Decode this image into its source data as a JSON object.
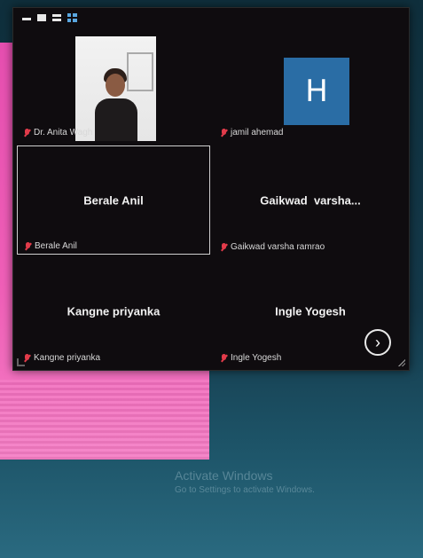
{
  "toolbar": {
    "icons": [
      "minimize-icon",
      "maximize-icon",
      "two-row-layout-icon",
      "grid-layout-icon"
    ]
  },
  "participants": [
    {
      "label": "Dr. Anita Wagh",
      "display": "video",
      "muted": true
    },
    {
      "label": "jamil ahemad",
      "display": "avatar",
      "avatar_letter": "H",
      "avatar_color": "#2a6da5",
      "muted": true
    },
    {
      "label": "Berale Anil",
      "display": "name",
      "center_name": "Berale Anil",
      "muted": true,
      "selected": true
    },
    {
      "label": "Gaikwad varsha ramrao",
      "display": "name",
      "center_name": "Gaikwad  varsha...",
      "muted": true
    },
    {
      "label": "Kangne priyanka",
      "display": "name",
      "center_name": "Kangne priyanka",
      "muted": true
    },
    {
      "label": "Ingle Yogesh",
      "display": "name",
      "center_name": "Ingle Yogesh",
      "muted": true
    }
  ],
  "next_button": {
    "glyph": "›"
  },
  "watermark": {
    "title": "Activate Windows",
    "subtitle": "Go to Settings to activate Windows."
  },
  "colors": {
    "background": "#14394a",
    "pink_window": "#f060b8",
    "muted_mic": "#e23b4a",
    "accent_blue": "#5aa7e0"
  }
}
